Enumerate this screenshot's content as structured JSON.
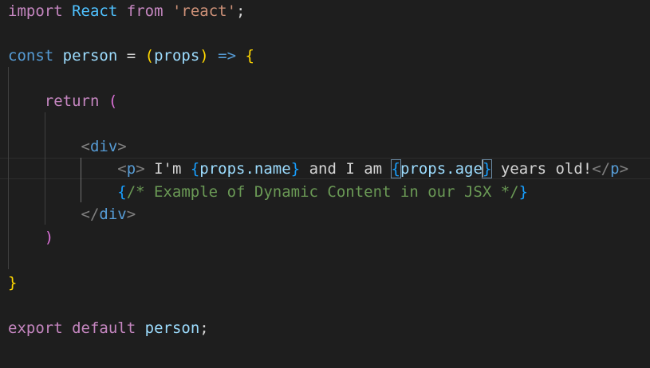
{
  "editor": {
    "lines": [
      {
        "import": "import",
        "react_name": "React",
        "from": "from",
        "module": "'react'",
        "semicolon": ";"
      },
      {
        "const": "const",
        "name": "person",
        "eq": " = ",
        "open_paren": "(",
        "param": "props",
        "close_paren": ")",
        "arrow": " => ",
        "open_brace": "{"
      },
      {
        "return": "return",
        "open_paren": "("
      },
      {
        "open_tag": "div"
      },
      {
        "p_tag": "p",
        "text1": " I'm ",
        "name_expr": "props.name",
        "text2": " and I am ",
        "age_expr": "props.age",
        "text3": " years old!",
        "p_close": "p"
      },
      {
        "comment": "/* Example of Dynamic Content in our JSX */"
      },
      {
        "close_tag": "div"
      },
      {
        "close_paren": ")"
      },
      {
        "close_brace": "}"
      },
      {
        "export": "export",
        "default": "default",
        "name": "person",
        "semicolon": ";"
      }
    ]
  },
  "colors": {
    "background": "#1e1e1e",
    "keyword_control": "#c586c0",
    "keyword": "#569cd6",
    "identifier": "#4fc1ff",
    "variable": "#9cdcfe",
    "string": "#ce9178",
    "comment": "#6a9955",
    "bracket_gold": "#ffd700",
    "bracket_orchid": "#da70d6",
    "bracket_blue": "#179fff"
  }
}
